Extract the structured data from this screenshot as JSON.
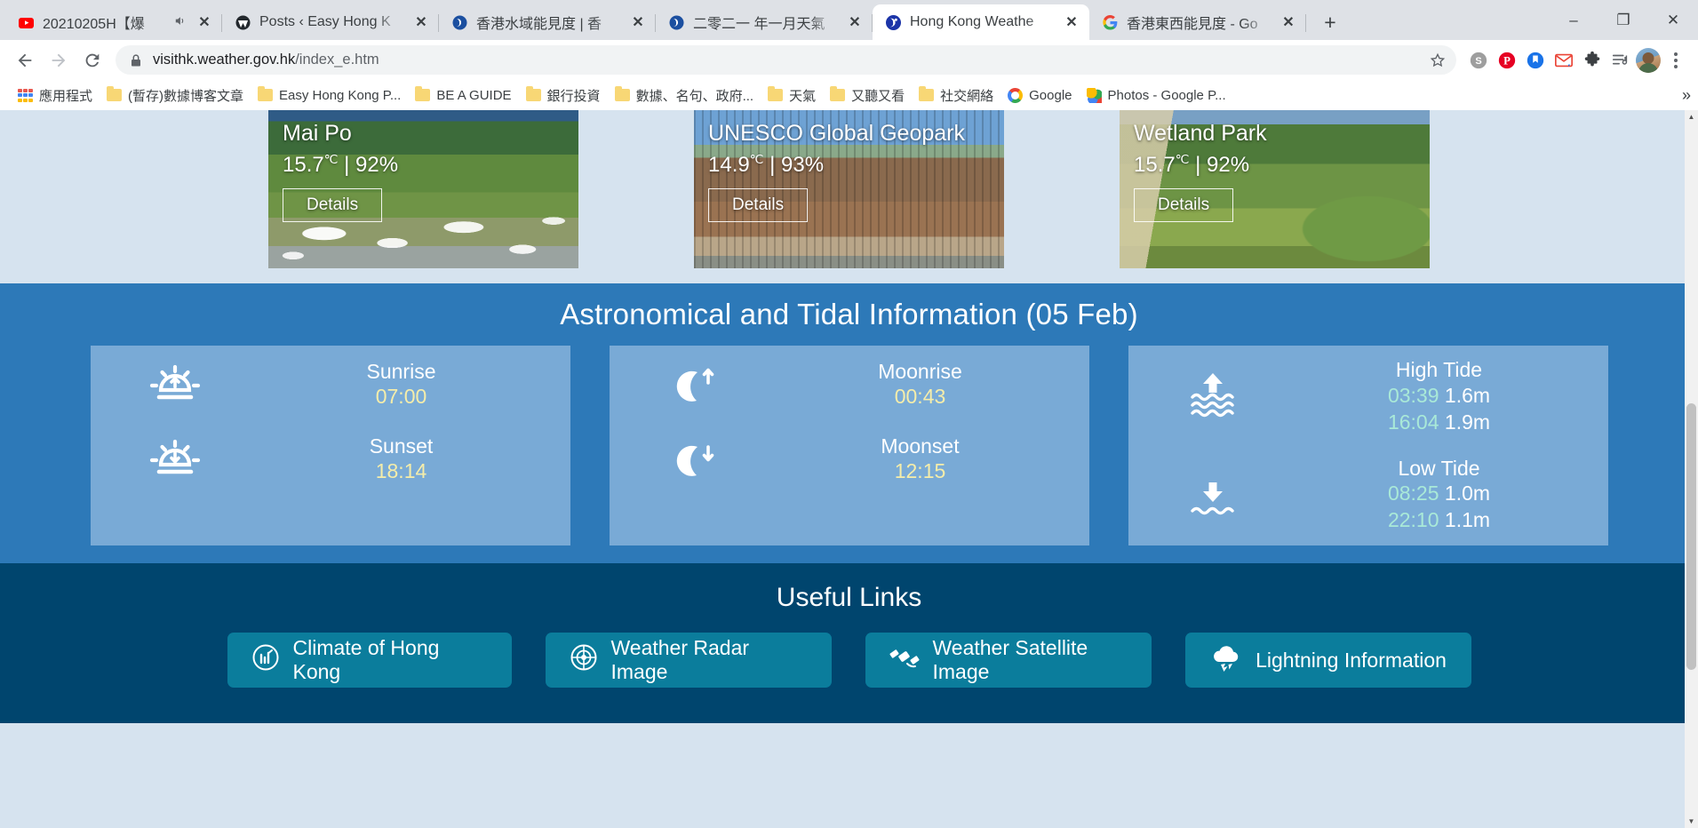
{
  "browser": {
    "tabs": [
      {
        "title": "20210205H【爆",
        "favicon": "youtube-icon",
        "audio": "speaker-icon",
        "active": false
      },
      {
        "title": "Posts ‹ Easy Hong K",
        "favicon": "wordpress-icon",
        "audio": "",
        "active": false
      },
      {
        "title": "香港水域能見度 | 香",
        "favicon": "hko-icon",
        "audio": "",
        "active": false
      },
      {
        "title": "二零二一 年一月天氣",
        "favicon": "hko-icon",
        "audio": "",
        "active": false
      },
      {
        "title": "Hong Kong Weathe",
        "favicon": "hko-icon",
        "audio": "",
        "active": true
      },
      {
        "title": "香港東西能見度 - Go",
        "favicon": "google-icon",
        "audio": "",
        "active": false
      }
    ],
    "new_tab_label": "+",
    "window_controls": {
      "minimize": "–",
      "maximize": "❐",
      "close": "✕"
    },
    "nav": {
      "back": "←",
      "forward": "→",
      "reload": "⟳"
    },
    "omnibox": {
      "lock_icon": "padlock-icon",
      "url_host": "visithk.weather.gov.hk",
      "url_path": "/index_e.htm",
      "star_icon": "bookmark-star-icon"
    },
    "extensions": [
      {
        "name": "skype-extension-icon",
        "glyph": "S",
        "color": "#9e9e9e"
      },
      {
        "name": "pinterest-extension-icon",
        "glyph": "P",
        "color": "#e60023"
      },
      {
        "name": "pocket-extension-icon",
        "glyph": "❚",
        "color": "#1a73e8"
      },
      {
        "name": "gmail-extension-icon",
        "glyph": "M",
        "color": "#ea4335"
      },
      {
        "name": "extensions-puzzle-icon",
        "glyph": "🧩",
        "color": "#5f6368"
      },
      {
        "name": "media-playlist-icon",
        "glyph": "♫",
        "color": "#5f6368"
      }
    ],
    "profile_avatar": "user-avatar",
    "menu": "chrome-menu-icon",
    "bookmarks": [
      {
        "label": "應用程式",
        "icon": "apps-grid-icon"
      },
      {
        "label": "(暫存)數據博客文章",
        "icon": "folder-icon"
      },
      {
        "label": "Easy Hong Kong P...",
        "icon": "folder-icon"
      },
      {
        "label": "BE A GUIDE",
        "icon": "folder-icon"
      },
      {
        "label": "銀行投資",
        "icon": "folder-icon"
      },
      {
        "label": "數據、名句、政府...",
        "icon": "folder-icon"
      },
      {
        "label": "天氣",
        "icon": "folder-icon"
      },
      {
        "label": "又聽又看",
        "icon": "folder-icon"
      },
      {
        "label": "社交網絡",
        "icon": "folder-icon"
      },
      {
        "label": "Google",
        "icon": "google-icon"
      },
      {
        "label": "Photos - Google P...",
        "icon": "google-photos-icon"
      }
    ],
    "bookmarks_overflow": "»"
  },
  "page": {
    "destination_cards": [
      {
        "name": "Mai Po",
        "temperature": "15.7",
        "unit": "℃",
        "separator": "|",
        "humidity": "92%",
        "details_label": "Details",
        "photo": "mai-po-wetland-birds"
      },
      {
        "name": "UNESCO Global Geopark",
        "temperature": "14.9",
        "unit": "℃",
        "separator": "|",
        "humidity": "93%",
        "details_label": "Details",
        "photo": "geopark-rock-columns"
      },
      {
        "name": "Wetland Park",
        "temperature": "15.7",
        "unit": "℃",
        "separator": "|",
        "humidity": "92%",
        "details_label": "Details",
        "photo": "wetland-park-boardwalk"
      }
    ],
    "astro": {
      "heading": "Astronomical and Tidal Information (05 Feb)",
      "sun": [
        {
          "icon": "sunrise-icon",
          "label": "Sunrise",
          "value": "07:00"
        },
        {
          "icon": "sunset-icon",
          "label": "Sunset",
          "value": "18:14"
        }
      ],
      "moon": [
        {
          "icon": "moonrise-icon",
          "label": "Moonrise",
          "value": "00:43"
        },
        {
          "icon": "moonset-icon",
          "label": "Moonset",
          "value": "12:15"
        }
      ],
      "tide": [
        {
          "icon": "high-tide-icon",
          "label": "High Tide",
          "entries": [
            {
              "time": "03:39",
              "height": "1.6m"
            },
            {
              "time": "16:04",
              "height": "1.9m"
            }
          ]
        },
        {
          "icon": "low-tide-icon",
          "label": "Low Tide",
          "entries": [
            {
              "time": "08:25",
              "height": "1.0m"
            },
            {
              "time": "22:10",
              "height": "1.1m"
            }
          ]
        }
      ]
    },
    "useful_links": {
      "heading": "Useful Links",
      "items": [
        {
          "label": "Climate of Hong Kong",
          "icon": "climate-globe-icon"
        },
        {
          "label": "Weather Radar Image",
          "icon": "radar-icon"
        },
        {
          "label": "Weather Satellite Image",
          "icon": "satellite-icon"
        },
        {
          "label": "Lightning Information",
          "icon": "lightning-cloud-icon"
        }
      ]
    }
  },
  "colors": {
    "astro_bg": "#2d79b8",
    "panel_bg": "#79aad6",
    "useful_bg": "#00456e",
    "link_btn": "#0b7d9c",
    "time_yellow": "#f5edaa",
    "tide_teal": "#a9e9d8",
    "page_bg": "#d6e3ef"
  }
}
